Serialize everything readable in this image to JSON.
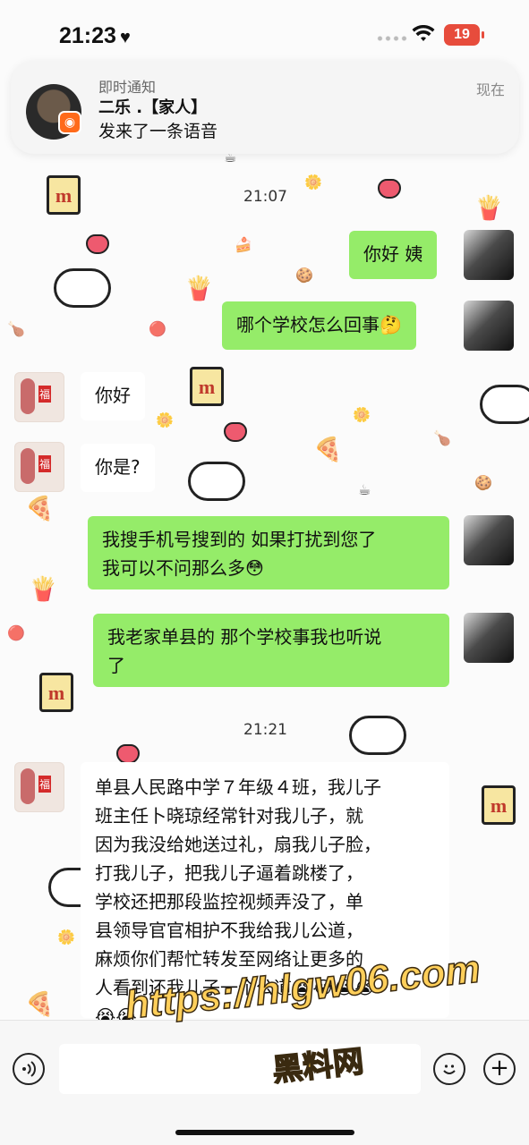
{
  "status_bar": {
    "time": "21:23",
    "battery": "19"
  },
  "notification": {
    "category": "即时通知",
    "sender": "二乐 .【家人】",
    "message": "发来了一条语音",
    "time": "现在"
  },
  "chat": {
    "timestamps": [
      "21:07",
      "21:21"
    ],
    "messages": [
      {
        "from": "me",
        "text": "你好 姨"
      },
      {
        "from": "me",
        "text": "哪个学校怎么回事",
        "emoji": "🤔"
      },
      {
        "from": "them",
        "text": "你好"
      },
      {
        "from": "them",
        "text": "你是?"
      },
      {
        "from": "me",
        "line1": "我搜手机号搜到的 如果打扰到您了",
        "line2": "我可以不问那么多",
        "emoji": "😳"
      },
      {
        "from": "me",
        "line1": "我老家单县的 那个学校事我也听说",
        "line2": "了"
      },
      {
        "from": "them",
        "lines": [
          "单县人民路中学７年级４班，我儿子",
          "班主任卜晓琼经常针对我儿子，就",
          "因为我没给她送过礼，扇我儿子脸，",
          "打我儿子，把我儿子逼着跳楼了，",
          "学校还把那段监控视频弄没了，单",
          "县领导官官相护不我给我儿公道，",
          "麻烦你们帮忙转发至网络让更多的",
          "人看到还我儿子一个公道"
        ],
        "emoji_tail": "😭😭😭😭",
        "emoji_line": "😭😭"
      }
    ]
  },
  "watermark": {
    "url": "https://hlgw06.com",
    "name": "黑料网"
  },
  "icons": {
    "voice": "voice-icon",
    "emoji": "emoji-icon",
    "plus": "plus-icon"
  }
}
